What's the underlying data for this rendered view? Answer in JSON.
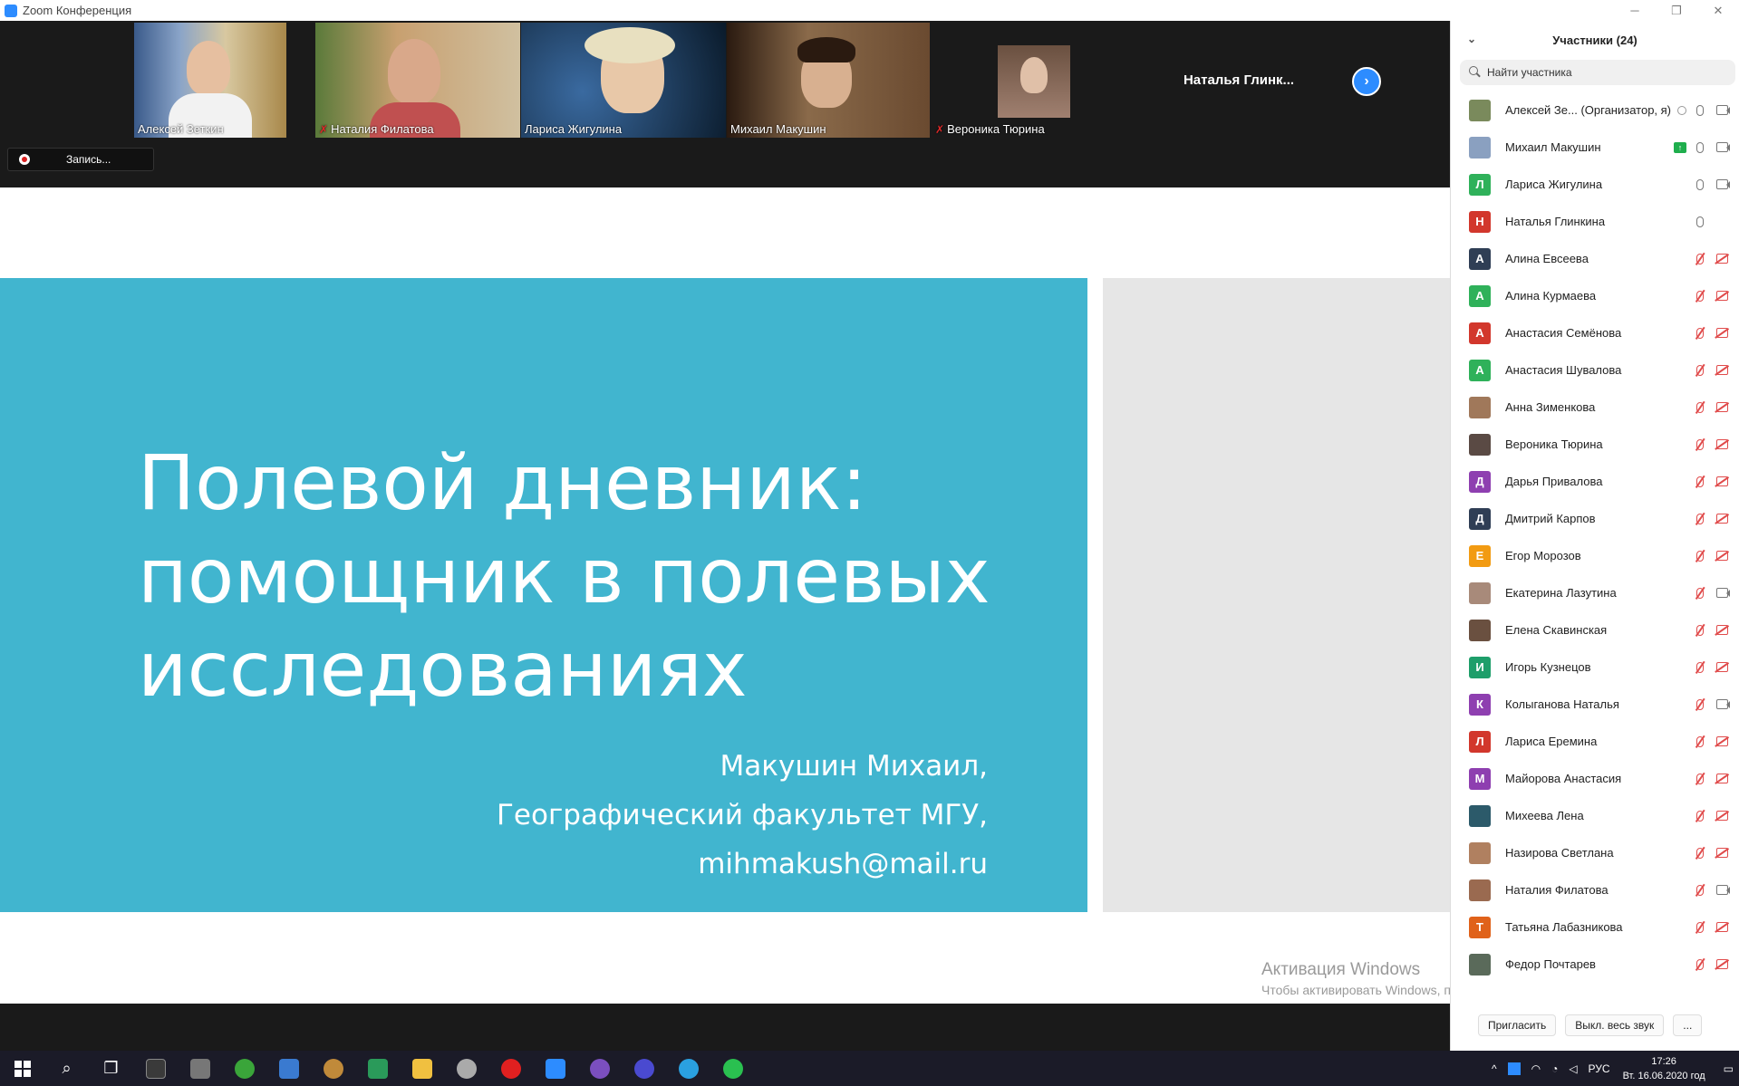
{
  "window": {
    "title": "Zoom Конференция",
    "minimize": "─",
    "maximize": "❐",
    "close": "✕"
  },
  "gallery": {
    "tiles": [
      {
        "name": "Алексей Зеткин",
        "muted": false
      },
      {
        "name": "Наталия Филатова",
        "muted": true
      },
      {
        "name": "Лариса Жигулина",
        "muted": false
      },
      {
        "name": "Михаил Макушин",
        "muted": false,
        "active": true
      },
      {
        "name": "Вероника Тюрина",
        "muted": true
      }
    ],
    "name_only_tile": "Наталья  Глинк...",
    "next_icon": "›"
  },
  "recording": {
    "label": "Запись..."
  },
  "slide": {
    "headline": [
      "Полевой дневник:",
      "помощник в полевых",
      "исследованиях"
    ],
    "author": [
      "Макушин Михаил,",
      "Географический факультет МГУ,",
      "mihmakush@mail.ru"
    ]
  },
  "watermark": {
    "line1": "Активация Windows",
    "line2": "Чтобы активировать Windows, перейдите в раздел \"Параметры\"."
  },
  "panel": {
    "title": "Участники (24)",
    "collapse_icon": "⌄",
    "search_placeholder": "Найти участника",
    "participants": [
      {
        "name": "Алексей Зе... (Организатор, я)",
        "initial": "",
        "color": "#7a8a5c",
        "mic": "on",
        "cam": "on",
        "extra": "rec"
      },
      {
        "name": "Михаил Макушин",
        "initial": "",
        "color": "#8aa0c0",
        "mic": "on",
        "cam": "on",
        "extra": "share"
      },
      {
        "name": "Лариса Жигулина",
        "initial": "Л",
        "color": "#2fb15a",
        "mic": "on",
        "cam": "on"
      },
      {
        "name": "Наталья Глинкина",
        "initial": "Н",
        "color": "#d2372c",
        "mic": "on",
        "cam": "none"
      },
      {
        "name": "Алина Евсеева",
        "initial": "А",
        "color": "#2f3e55",
        "mic": "off",
        "cam": "off"
      },
      {
        "name": "Алина Курмаева",
        "initial": "А",
        "color": "#2fb15a",
        "mic": "off",
        "cam": "off"
      },
      {
        "name": "Анастасия Семёнова",
        "initial": "А",
        "color": "#d2372c",
        "mic": "off",
        "cam": "off"
      },
      {
        "name": "Анастасия Шувалова",
        "initial": "А",
        "color": "#2fb15a",
        "mic": "off",
        "cam": "off"
      },
      {
        "name": "Анна Зименкова",
        "initial": "",
        "color": "#a0785a",
        "mic": "off",
        "cam": "off"
      },
      {
        "name": "Вероника Тюрина",
        "initial": "",
        "color": "#5a4a44",
        "mic": "off",
        "cam": "off"
      },
      {
        "name": "Дарья Привалова",
        "initial": "Д",
        "color": "#8e3fb0",
        "mic": "off",
        "cam": "off"
      },
      {
        "name": "Дмитрий Карпов",
        "initial": "Д",
        "color": "#2f3e55",
        "mic": "off",
        "cam": "off"
      },
      {
        "name": "Егор Морозов",
        "initial": "Е",
        "color": "#f29b12",
        "mic": "off",
        "cam": "off"
      },
      {
        "name": "Екатерина Лазутина",
        "initial": "",
        "color": "#a88a7a",
        "mic": "off",
        "cam": "on"
      },
      {
        "name": "Елена Скавинская",
        "initial": "",
        "color": "#6a5040",
        "mic": "off",
        "cam": "off"
      },
      {
        "name": "Игорь Кузнецов",
        "initial": "И",
        "color": "#1e9e6a",
        "mic": "off",
        "cam": "off"
      },
      {
        "name": "Колыганова Наталья",
        "initial": "К",
        "color": "#8e3fb0",
        "mic": "off",
        "cam": "on"
      },
      {
        "name": "Лариса Еремина",
        "initial": "Л",
        "color": "#d2372c",
        "mic": "off",
        "cam": "off"
      },
      {
        "name": "Майорова Анастасия",
        "initial": "М",
        "color": "#8e3fb0",
        "mic": "off",
        "cam": "off"
      },
      {
        "name": "Михеева Лена",
        "initial": "",
        "color": "#2c5a6a",
        "mic": "off",
        "cam": "off"
      },
      {
        "name": "Назирова Светлана",
        "initial": "",
        "color": "#b08060",
        "mic": "off",
        "cam": "off"
      },
      {
        "name": "Наталия Филатова",
        "initial": "",
        "color": "#9a6a50",
        "mic": "off",
        "cam": "on"
      },
      {
        "name": "Татьяна Лабазникова",
        "initial": "Т",
        "color": "#e0621a",
        "mic": "off",
        "cam": "off"
      },
      {
        "name": "Федор Почтарев",
        "initial": "",
        "color": "#5a6a5a",
        "mic": "off",
        "cam": "off"
      }
    ],
    "buttons": {
      "invite": "Пригласить",
      "mute_all": "Выкл. весь звук",
      "more": "..."
    }
  },
  "taskbar": {
    "tray": {
      "caret": "^",
      "lang": "РУС",
      "time": "17:26",
      "date": "Вт. 16.06.2020 год"
    }
  }
}
